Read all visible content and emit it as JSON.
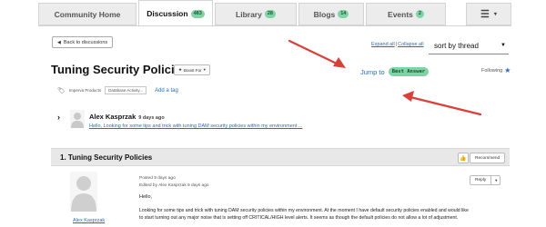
{
  "tabs": [
    {
      "label": "Community Home",
      "badge": null
    },
    {
      "label": "Discussion",
      "badge": "483",
      "active": true
    },
    {
      "label": "Library",
      "badge": "28"
    },
    {
      "label": "Blogs",
      "badge": "14"
    },
    {
      "label": "Events",
      "badge": "2"
    }
  ],
  "tab_menu": {
    "icon": "hamburger-icon",
    "glyph": "☰",
    "caret": "▾"
  },
  "toolbar": {
    "back_label": "Back to discussions",
    "expand_all": "Expand all",
    "separator": "|",
    "collapse_all": "Collapse all",
    "sort_selected": "sort by thread"
  },
  "thread": {
    "title": "Tuning Security Policies",
    "boost_label": "Boost For",
    "jump_label": "Jump to",
    "best_answer": "Best Answer",
    "following_label": "Following",
    "tags": [
      "Imperva Products",
      "Database Activity..."
    ],
    "add_tag": "Add a tag"
  },
  "summary": {
    "author": "Alex Kasprzak",
    "when": "9 days ago",
    "link_text": "Hello, Looking for some tips and trick with tuning DAM security policies within my environment ..."
  },
  "reply": {
    "title": "1.  Tuning Security Policies",
    "recommend_label": "Recommend",
    "reply_label": "Reply",
    "posted": "Posted 9 days ago",
    "edited": "Edited by Alex Kasprzak 9 days ago",
    "greeting": "Hello,",
    "body_line1": "Looking for some tips and trick with tuning DAM security policies within my environment. At the moment I have default security policies enabled and would like",
    "body_line2": "to start turning out any major noise that is setting off CRITICAL/HIGH level alerts. It seems as though the default policies do not allow a lot of adjustment.",
    "author": "Alex Kasprzak"
  },
  "colors": {
    "badge": "#7fd3a4",
    "link": "#2a6fb5",
    "arrow": "#d9403a"
  }
}
